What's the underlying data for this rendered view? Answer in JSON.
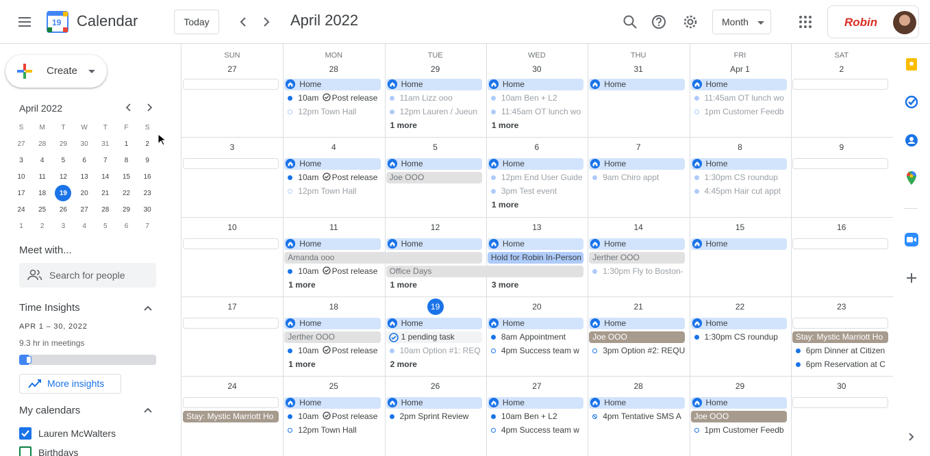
{
  "header": {
    "app_title": "Calendar",
    "logo_number": "19",
    "today_label": "Today",
    "current_period": "April 2022",
    "view_label": "Month",
    "brand_label": "Robin"
  },
  "sidebar": {
    "create_label": "Create",
    "mini_cal": {
      "title": "April 2022",
      "weekday_headers": [
        "S",
        "M",
        "T",
        "W",
        "T",
        "F",
        "S"
      ],
      "weeks": [
        [
          "27",
          "28",
          "29",
          "30",
          "31",
          "1",
          "2"
        ],
        [
          "3",
          "4",
          "5",
          "6",
          "7",
          "8",
          "9"
        ],
        [
          "10",
          "11",
          "12",
          "13",
          "14",
          "15",
          "16"
        ],
        [
          "17",
          "18",
          "19",
          "20",
          "21",
          "22",
          "23"
        ],
        [
          "24",
          "25",
          "26",
          "27",
          "28",
          "29",
          "30"
        ],
        [
          "1",
          "2",
          "3",
          "4",
          "5",
          "6",
          "7"
        ]
      ],
      "today": "19"
    },
    "meet_with_title": "Meet with...",
    "search_people_placeholder": "Search for people",
    "time_insights": {
      "title": "Time Insights",
      "range": "APR 1 – 30, 2022",
      "summary": "9.3 hr in meetings",
      "progress_fraction": 0.07,
      "more_label": "More insights"
    },
    "my_calendars": {
      "title": "My calendars",
      "items": [
        {
          "label": "Lauren McWalters",
          "checked": true,
          "color": "#1a73e8"
        },
        {
          "label": "Birthdays",
          "checked": false,
          "color": "#0b8043"
        }
      ]
    }
  },
  "grid": {
    "weekdays": [
      "SUN",
      "MON",
      "TUE",
      "WED",
      "THU",
      "FRI",
      "SAT"
    ],
    "weeks": [
      {
        "days": [
          "27",
          "28",
          "29",
          "30",
          "31",
          "Apr 1",
          "2"
        ],
        "events": [
          {
            "col": 0,
            "row": 0,
            "type": "emptyhome",
            "label": ""
          },
          {
            "col": 1,
            "row": 0,
            "type": "home",
            "label": "Home"
          },
          {
            "col": 1,
            "row": 1,
            "type": "timed",
            "dot": "filled",
            "color": "#1a73e8",
            "time": "10am",
            "title": "Post release",
            "task": true
          },
          {
            "col": 1,
            "row": 2,
            "type": "timed",
            "dot": "outline",
            "color": "#aecbfa",
            "time": "12pm",
            "title": "Town Hall",
            "faded": true
          },
          {
            "col": 2,
            "row": 0,
            "type": "home",
            "label": "Home"
          },
          {
            "col": 2,
            "row": 1,
            "type": "timed",
            "dot": "filled",
            "color": "#aecbfa",
            "time": "11am",
            "title": "Lizz ooo",
            "faded": true
          },
          {
            "col": 2,
            "row": 2,
            "type": "timed",
            "dot": "filled",
            "color": "#aecbfa",
            "time": "12pm",
            "title": "Lauren / Jueun",
            "faded": true
          },
          {
            "col": 2,
            "row": 3,
            "type": "more",
            "label": "1 more"
          },
          {
            "col": 3,
            "row": 0,
            "type": "home",
            "label": "Home"
          },
          {
            "col": 3,
            "row": 1,
            "type": "timed",
            "dot": "filled",
            "color": "#aecbfa",
            "time": "10am",
            "title": "Ben + L2",
            "faded": true
          },
          {
            "col": 3,
            "row": 2,
            "type": "timed",
            "dot": "filled",
            "color": "#aecbfa",
            "time": "11:45am",
            "title": "OT lunch wo",
            "faded": true
          },
          {
            "col": 3,
            "row": 3,
            "type": "more",
            "label": "1 more"
          },
          {
            "col": 4,
            "row": 0,
            "type": "home",
            "label": "Home"
          },
          {
            "col": 5,
            "row": 0,
            "type": "home",
            "label": "Home"
          },
          {
            "col": 5,
            "row": 1,
            "type": "timed",
            "dot": "filled",
            "color": "#aecbfa",
            "time": "11:45am",
            "title": "OT lunch wo",
            "faded": true
          },
          {
            "col": 5,
            "row": 2,
            "type": "timed",
            "dot": "outline",
            "color": "#aecbfa",
            "time": "1pm",
            "title": "Customer Feedb",
            "faded": true
          },
          {
            "col": 6,
            "row": 0,
            "type": "emptyhome",
            "label": ""
          }
        ]
      },
      {
        "days": [
          "3",
          "4",
          "5",
          "6",
          "7",
          "8",
          "9"
        ],
        "events": [
          {
            "col": 0,
            "row": 0,
            "type": "emptyhome",
            "label": ""
          },
          {
            "col": 1,
            "row": 0,
            "type": "home",
            "label": "Home"
          },
          {
            "col": 1,
            "row": 1,
            "type": "timed",
            "dot": "filled",
            "color": "#1a73e8",
            "time": "10am",
            "title": "Post release",
            "task": true
          },
          {
            "col": 1,
            "row": 2,
            "type": "timed",
            "dot": "outline",
            "color": "#aecbfa",
            "time": "12pm",
            "title": "Town Hall",
            "faded": true
          },
          {
            "col": 2,
            "row": 0,
            "type": "home",
            "label": "Home"
          },
          {
            "col": 2,
            "row": 1,
            "type": "ooo",
            "label": "Joe OOO",
            "span": 1
          },
          {
            "col": 3,
            "row": 0,
            "type": "home",
            "label": "Home"
          },
          {
            "col": 3,
            "row": 1,
            "type": "timed",
            "dot": "filled",
            "color": "#aecbfa",
            "time": "12pm",
            "title": "End User Guide",
            "faded": true
          },
          {
            "col": 3,
            "row": 2,
            "type": "timed",
            "dot": "filled",
            "color": "#aecbfa",
            "time": "3pm",
            "title": "Test event",
            "faded": true
          },
          {
            "col": 3,
            "row": 3,
            "type": "more",
            "label": "1 more"
          },
          {
            "col": 4,
            "row": 0,
            "type": "home",
            "label": "Home"
          },
          {
            "col": 4,
            "row": 1,
            "type": "timed",
            "dot": "filled",
            "color": "#aecbfa",
            "time": "9am",
            "title": "Chiro appt",
            "faded": true
          },
          {
            "col": 5,
            "row": 0,
            "type": "home",
            "label": "Home"
          },
          {
            "col": 5,
            "row": 1,
            "type": "timed",
            "dot": "filled",
            "color": "#aecbfa",
            "time": "1:30pm",
            "title": "CS roundup",
            "faded": true
          },
          {
            "col": 5,
            "row": 2,
            "type": "timed",
            "dot": "filled",
            "color": "#aecbfa",
            "time": "4:45pm",
            "title": "Hair cut appt",
            "faded": true
          },
          {
            "col": 6,
            "row": 0,
            "type": "emptyhome",
            "label": ""
          }
        ]
      },
      {
        "days": [
          "10",
          "11",
          "12",
          "13",
          "14",
          "15",
          "16"
        ],
        "events": [
          {
            "col": 0,
            "row": 0,
            "type": "emptyhome",
            "label": ""
          },
          {
            "col": 1,
            "row": 0,
            "type": "home",
            "label": "Home"
          },
          {
            "col": 1,
            "row": 1,
            "type": "ooo",
            "label": "Amanda ooo",
            "span": 2
          },
          {
            "col": 1,
            "row": 2,
            "type": "timed",
            "dot": "filled",
            "color": "#1a73e8",
            "time": "10am",
            "title": "Post release",
            "task": true
          },
          {
            "col": 1,
            "row": 3,
            "type": "more",
            "label": "1 more"
          },
          {
            "col": 2,
            "row": 0,
            "type": "home",
            "label": "Home"
          },
          {
            "col": 2,
            "row": 2,
            "type": "ooo",
            "label": "Office Days",
            "span": 2
          },
          {
            "col": 2,
            "row": 3,
            "type": "more",
            "label": "1 more"
          },
          {
            "col": 3,
            "row": 0,
            "type": "home",
            "label": "Home"
          },
          {
            "col": 3,
            "row": 1,
            "type": "holdBlue",
            "label": "Hold for Robin In-Person",
            "span": 1
          },
          {
            "col": 3,
            "row": 3,
            "type": "more",
            "label": "3 more"
          },
          {
            "col": 4,
            "row": 0,
            "type": "home",
            "label": "Home"
          },
          {
            "col": 4,
            "row": 1,
            "type": "ooo",
            "label": "Jerther OOO",
            "span": 1
          },
          {
            "col": 4,
            "row": 2,
            "type": "timed",
            "dot": "filled",
            "color": "#aecbfa",
            "time": "1:30pm",
            "title": "Fly to Boston-",
            "faded": true
          },
          {
            "col": 5,
            "row": 0,
            "type": "home",
            "label": "Home"
          },
          {
            "col": 6,
            "row": 0,
            "type": "emptyhome",
            "label": ""
          }
        ]
      },
      {
        "days": [
          "17",
          "18",
          "19",
          "20",
          "21",
          "22",
          "23"
        ],
        "today_col": 2,
        "events": [
          {
            "col": 0,
            "row": 0,
            "type": "emptyhome",
            "label": ""
          },
          {
            "col": 1,
            "row": 0,
            "type": "home",
            "label": "Home"
          },
          {
            "col": 1,
            "row": 1,
            "type": "ooo",
            "label": "Jerther OOO",
            "span": 1
          },
          {
            "col": 1,
            "row": 2,
            "type": "timed",
            "dot": "filled",
            "color": "#1a73e8",
            "time": "10am",
            "title": "Post release",
            "task": true
          },
          {
            "col": 1,
            "row": 3,
            "type": "more",
            "label": "1 more"
          },
          {
            "col": 2,
            "row": 0,
            "type": "home",
            "label": "Home"
          },
          {
            "col": 2,
            "row": 1,
            "type": "tasks",
            "label": "1 pending task"
          },
          {
            "col": 2,
            "row": 2,
            "type": "timed",
            "dot": "filled",
            "color": "#aecbfa",
            "time": "10am",
            "title": "Option #1: REQ",
            "faded": true
          },
          {
            "col": 2,
            "row": 3,
            "type": "more",
            "label": "2 more"
          },
          {
            "col": 3,
            "row": 0,
            "type": "home",
            "label": "Home"
          },
          {
            "col": 3,
            "row": 1,
            "type": "timed",
            "dot": "filled",
            "color": "#1a73e8",
            "time": "8am",
            "title": "Appointment"
          },
          {
            "col": 3,
            "row": 2,
            "type": "timed",
            "dot": "outline",
            "color": "#1a73e8",
            "time": "4pm",
            "title": "Success team w"
          },
          {
            "col": 4,
            "row": 0,
            "type": "home",
            "label": "Home"
          },
          {
            "col": 4,
            "row": 1,
            "type": "oooBrown",
            "label": "Joe OOO",
            "span": 1
          },
          {
            "col": 4,
            "row": 2,
            "type": "timed",
            "dot": "outline",
            "color": "#1a73e8",
            "time": "3pm",
            "title": "Option #2: REQU"
          },
          {
            "col": 5,
            "row": 0,
            "type": "home",
            "label": "Home"
          },
          {
            "col": 5,
            "row": 1,
            "type": "timed",
            "dot": "filled",
            "color": "#1a73e8",
            "time": "1:30pm",
            "title": "CS roundup"
          },
          {
            "col": 6,
            "row": 0,
            "type": "emptyhome",
            "label": ""
          },
          {
            "col": 6,
            "row": 1,
            "type": "oooBrown",
            "label": "Stay: Mystic Marriott Ho",
            "span": 1
          },
          {
            "col": 6,
            "row": 2,
            "type": "timed",
            "dot": "filled",
            "color": "#1a73e8",
            "time": "6pm",
            "title": "Dinner at Citizen"
          },
          {
            "col": 6,
            "row": 3,
            "type": "timed",
            "dot": "filled",
            "color": "#1a73e8",
            "time": "6pm",
            "title": "Reservation at C"
          }
        ]
      },
      {
        "days": [
          "24",
          "25",
          "26",
          "27",
          "28",
          "29",
          "30"
        ],
        "events": [
          {
            "col": 0,
            "row": 0,
            "type": "emptyhome",
            "label": ""
          },
          {
            "col": 0,
            "row": 1,
            "type": "oooBrown",
            "label": "Stay: Mystic Marriott Ho",
            "span": 1
          },
          {
            "col": 1,
            "row": 0,
            "type": "home",
            "label": "Home"
          },
          {
            "col": 1,
            "row": 1,
            "type": "timed",
            "dot": "filled",
            "color": "#1a73e8",
            "time": "10am",
            "title": "Post release",
            "task": true
          },
          {
            "col": 1,
            "row": 2,
            "type": "timed",
            "dot": "outline",
            "color": "#1a73e8",
            "time": "12pm",
            "title": "Town Hall"
          },
          {
            "col": 2,
            "row": 0,
            "type": "home",
            "label": "Home"
          },
          {
            "col": 2,
            "row": 1,
            "type": "timed",
            "dot": "filled",
            "color": "#1a73e8",
            "time": "2pm",
            "title": "Sprint Review"
          },
          {
            "col": 3,
            "row": 0,
            "type": "home",
            "label": "Home"
          },
          {
            "col": 3,
            "row": 1,
            "type": "timed",
            "dot": "filled",
            "color": "#1a73e8",
            "time": "10am",
            "title": "Ben + L2"
          },
          {
            "col": 3,
            "row": 2,
            "type": "timed",
            "dot": "outline",
            "color": "#1a73e8",
            "time": "4pm",
            "title": "Success team w"
          },
          {
            "col": 4,
            "row": 0,
            "type": "home",
            "label": "Home"
          },
          {
            "col": 4,
            "row": 1,
            "type": "timed",
            "dot": "striped",
            "color": "#1a73e8",
            "time": "4pm",
            "title": "Tentative SMS A"
          },
          {
            "col": 5,
            "row": 0,
            "type": "home",
            "label": "Home"
          },
          {
            "col": 5,
            "row": 1,
            "type": "oooBrown",
            "label": "Joe OOO",
            "span": 1
          },
          {
            "col": 5,
            "row": 2,
            "type": "timed",
            "dot": "outline",
            "color": "#1a73e8",
            "time": "1pm",
            "title": "Customer Feedb"
          },
          {
            "col": 6,
            "row": 0,
            "type": "emptyhome",
            "label": ""
          }
        ]
      }
    ]
  },
  "right_panel": {
    "icons": [
      "keep-icon",
      "tasks-icon",
      "contacts-icon",
      "maps-icon",
      "zoom-icon",
      "add-icon"
    ]
  }
}
